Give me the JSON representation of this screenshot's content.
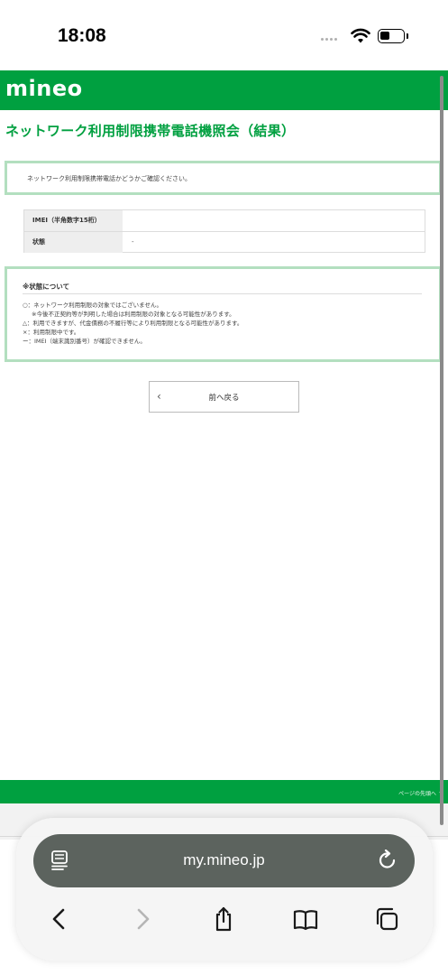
{
  "status_bar": {
    "time": "18:08",
    "wifi_icon": "wifi-icon",
    "battery_icon": "battery-icon"
  },
  "header": {
    "logo": "mineo",
    "brand_color": "#00a040"
  },
  "page": {
    "title": "ネットワーク利用制限携帯電話機照会（結果）",
    "notice": "ネットワーク利用制限携帯電話かどうかご確認ください。",
    "table": [
      {
        "label": "IMEI（半角数字15桁）",
        "value": ""
      },
      {
        "label": "状態",
        "value": "-"
      }
    ],
    "status_section": {
      "title": "※状態について",
      "lines": [
        "○：ネットワーク利用制限の対象ではございません。",
        "※今後不正契約等が判明した場合は利用制限の対象となる可能性があります。",
        "△：利用できますが、代金債務の不履行等により利用制限となる可能性があります。",
        "×：利用制限中です。",
        "ー：IMEI（端末識別番号）が確認できません。"
      ]
    },
    "back_button": "前へ戻る"
  },
  "footer": {
    "page_top": "ページの先頭へ ↑"
  },
  "browser": {
    "url": "my.mineo.jp",
    "icons": [
      "reader-icon",
      "reload-icon",
      "back-icon",
      "forward-icon",
      "share-icon",
      "bookmarks-icon",
      "tabs-icon"
    ]
  }
}
